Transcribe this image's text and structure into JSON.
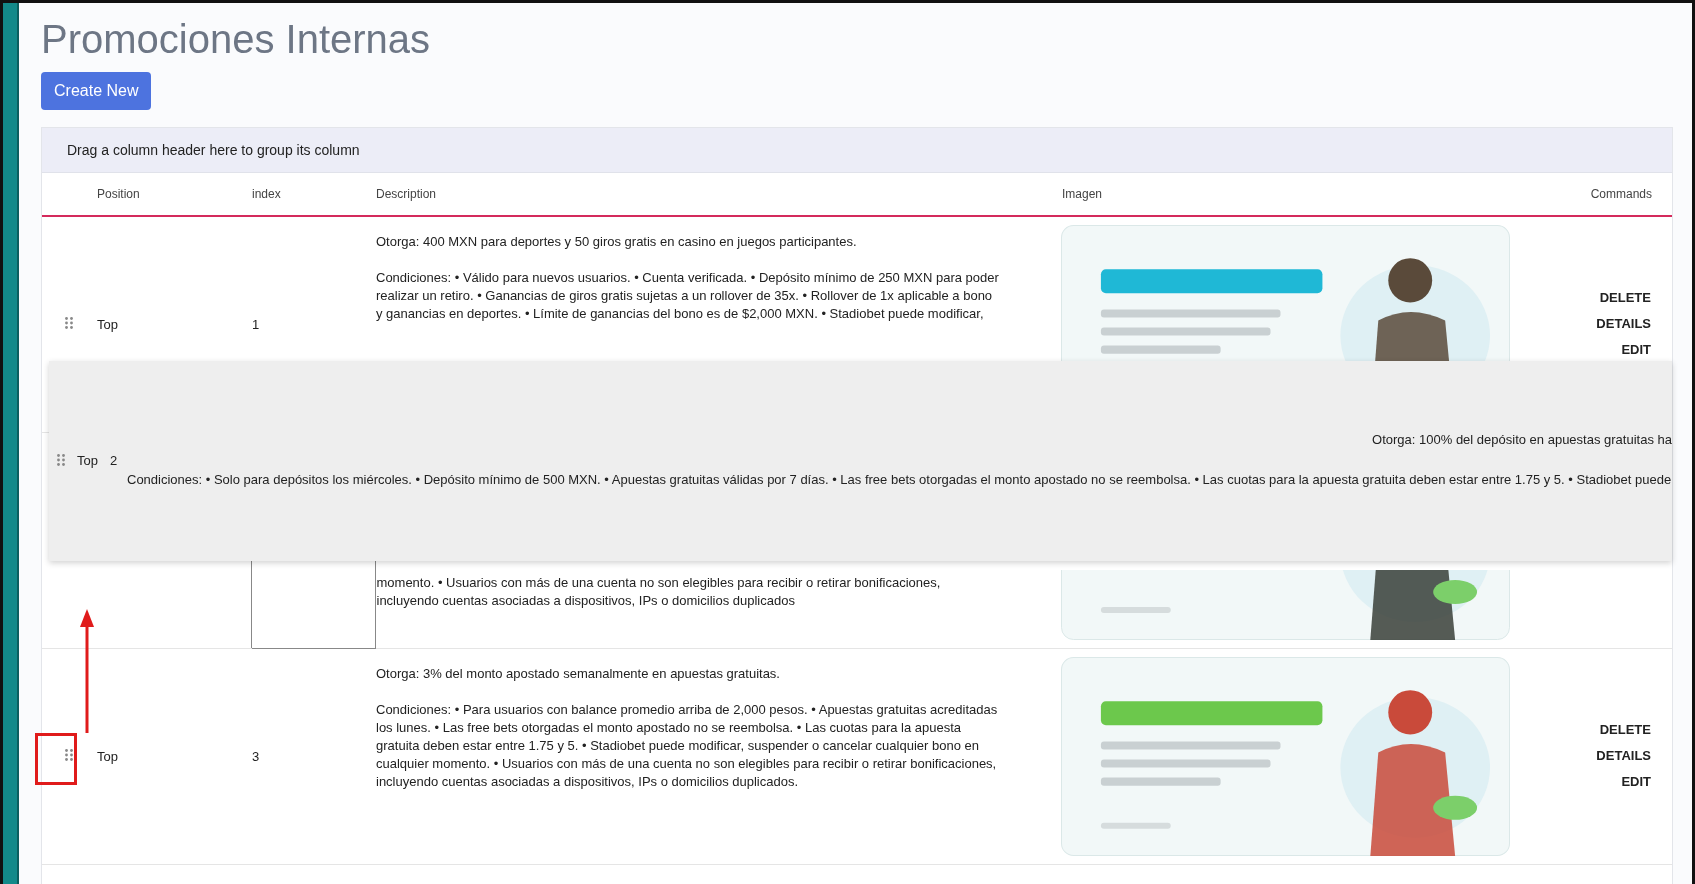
{
  "page": {
    "title": "Promociones Internas",
    "create_button": "Create New"
  },
  "grid": {
    "group_panel": "Drag a column header here to group its column",
    "columns": [
      {
        "label": "Position"
      },
      {
        "label": "index"
      },
      {
        "label": "Description"
      },
      {
        "label": "Imagen"
      },
      {
        "label": "Commands"
      }
    ],
    "rows": [
      {
        "position": "Top",
        "index": "1",
        "description": [
          "Otorga: 400 MXN para deportes y 50 giros gratis en casino en juegos participantes.",
          "Condiciones: • Válido para nuevos usuarios. • Cuenta verificada. • Depósito mínimo de 250 MXN para poder realizar un retiro. • Ganancias de giros gratis sujetas a un rollover de 35x. • Rollover de 1x aplicable a bono y ganancias en deportes. • Límite de ganancias del bono es de $2,000 MXN. • Stadiobet puede modificar,"
        ],
        "image": {
          "kind": "picture"
        },
        "commands": [
          "DELETE",
          "DETAILS",
          "EDIT"
        ],
        "drop_target": false
      },
      {
        "description": [
          "momento. • Usuarios con más de una cuenta no son elegibles para recibir o retirar bonificaciones, incluyendo cuentas asociadas a dispositivos, IPs o domicilios duplicados"
        ],
        "image": {
          "kind": "picture"
        },
        "drop_target": true
      },
      {
        "position": "Top",
        "index": "3",
        "description": [
          "Otorga: 3% del monto apostado semanalmente en apuestas gratuitas.",
          "Condiciones: • Para usuarios con balance promedio arriba de 2,000 pesos. • Apuestas gratuitas acreditadas los lunes. • Las free bets otorgadas el monto apostado no se reembolsa. • Las cuotas para la apuesta gratuita deben estar entre 1.75 y 5. • Stadiobet puede modificar, suspender o cancelar cualquier bono en cualquier momento. • Usuarios con más de una cuenta no son elegibles para recibir o retirar bonificaciones, incluyendo cuentas asociadas a dispositivos, IPs o domicilios duplicados."
        ],
        "image": {
          "kind": "picture"
        },
        "commands": [
          "DELETE",
          "DETAILS",
          "EDIT"
        ],
        "drop_target": false
      }
    ],
    "drag_preview": {
      "position": "Top",
      "index": "2",
      "description": [
        "Otorga: 100% del depósito en apuestas gratuitas ha",
        "Condiciones: • Solo para depósitos los miércoles. • Depósito mínimo de 500 MXN. • Apuestas gratuitas válidas por 7 días. • Las free bets otorgadas el monto apostado no se reembolsa. • Las cuotas para la apuesta gratuita deben estar entre 1.75 y 5. • Stadiobet puede"
      ]
    }
  }
}
